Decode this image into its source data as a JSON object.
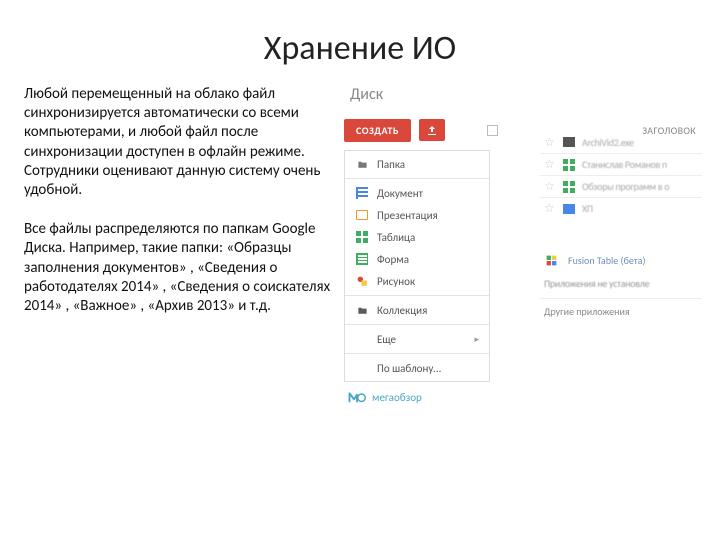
{
  "title": "Хранение ИО",
  "left": {
    "p1": "Любой перемещенный на облако файл синхронизируется автоматически со всеми компьютерами, и любой файл после синхронизации доступен в офлайн режиме. Сотрудники оценивают данную систему очень удобной.",
    "p2": "Все файлы распределяются по папкам Google Диска. Например, такие папки: «Образцы заполнения документов» , «Сведения о работодателях 2014» , «Сведения о соискателях 2014» , «Важное» , «Архив 2013» и т.д."
  },
  "drive": {
    "label": "Диск",
    "create": "СОЗДАТЬ",
    "column_title": "ЗАГОЛОВОК",
    "menu": {
      "folder": "Папка",
      "document": "Документ",
      "presentation": "Презентация",
      "sheets": "Таблица",
      "form": "Форма",
      "drawing": "Рисунок",
      "connections": "Коллекция",
      "more": "Еще",
      "template": "По шаблону..."
    },
    "files": {
      "f1": "ArchiVid2.exe",
      "f2": "Станислав Романов п",
      "f3": "Обзоры программ в о",
      "f4": "ХП"
    },
    "fusion": "Fusion Table (бета)",
    "not_installed": "Приложения не установле",
    "other_apps": "Другие приложения",
    "mega": "мегаобзор"
  }
}
